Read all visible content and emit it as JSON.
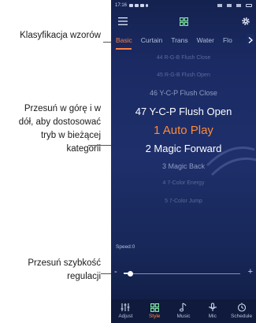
{
  "annotations": {
    "categories": "Klasyfikacja wzorów",
    "scroll_hint": "Przesuń w górę i w dół, aby dostosować tryb w bieżącej kategorii",
    "speed_hint": "Przesuń szybkość regulacji"
  },
  "status_bar": {
    "time": "17:16"
  },
  "tabs": [
    {
      "label": "Basic",
      "active": true
    },
    {
      "label": "Curtain"
    },
    {
      "label": "Trans"
    },
    {
      "label": "Water"
    },
    {
      "label": "Flo"
    }
  ],
  "modes": [
    {
      "label": "44 R-G-B Flush Close",
      "style": "s1"
    },
    {
      "label": "45 R-G-B Flush Open",
      "style": "s1"
    },
    {
      "label": "46 Y-C-P Flush Close",
      "style": "s2"
    },
    {
      "label": "47 Y-C-P Flush Open",
      "style": "s3"
    },
    {
      "label": "1 Auto Play",
      "style": "sel",
      "selected": true
    },
    {
      "label": "2 Magic Forward",
      "style": "s3"
    },
    {
      "label": "3 Magic Back",
      "style": "s2"
    },
    {
      "label": "4 7-Color Energy",
      "style": "s1"
    },
    {
      "label": "5 7-Color Jump",
      "style": "s1"
    }
  ],
  "speed": {
    "label": "Speed:0",
    "value": 0.06
  },
  "bottom_nav": [
    {
      "label": "Adjust",
      "icon": "sliders-icon"
    },
    {
      "label": "Style",
      "icon": "grid-icon",
      "active": true
    },
    {
      "label": "Music",
      "icon": "music-note-icon"
    },
    {
      "label": "Mic",
      "icon": "microphone-icon"
    },
    {
      "label": "Schedule",
      "icon": "clock-icon"
    }
  ],
  "colors": {
    "accent": "#ff8a3a",
    "tab_active": "#ff8040",
    "background_top": "#142250",
    "background_bottom": "#0f1b40",
    "nav_background": "#0f1a3c"
  }
}
